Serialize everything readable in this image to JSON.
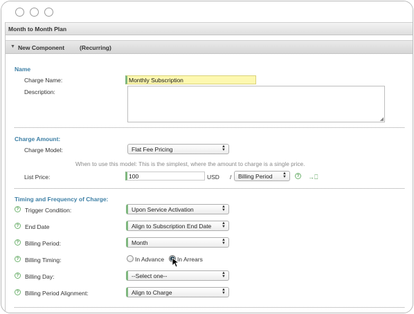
{
  "plan": {
    "title": "Month to Month Plan"
  },
  "component": {
    "label": "New Component",
    "type": "(Recurring)"
  },
  "sections": {
    "name": "Name",
    "charge_amount": "Charge Amount:",
    "timing": "Timing and Frequency of Charge:"
  },
  "fields": {
    "charge_name": {
      "label": "Charge Name:",
      "value": "Monthly Subscription"
    },
    "description": {
      "label": "Description:",
      "value": ""
    },
    "charge_model": {
      "label": "Charge Model:",
      "value": "Flat Fee Pricing",
      "hint": "When to use this model: This is the simplest, where the amount to charge is a single price."
    },
    "list_price": {
      "label": "List Price:",
      "value": "100",
      "currency": "USD",
      "separator": "/",
      "period": "Billing Period"
    },
    "trigger_condition": {
      "label": "Trigger Condition:",
      "value": "Upon Service Activation"
    },
    "end_date": {
      "label": "End Date",
      "value": "Align to Subscription End Date"
    },
    "billing_period": {
      "label": "Billing Period:",
      "value": "Month"
    },
    "billing_timing": {
      "label": "Billing Timing:",
      "option_advance": "In Advance",
      "option_arrears": "In Arrears",
      "selected": "In Arrears"
    },
    "billing_day": {
      "label": "Billing Day:",
      "value": "--Select one--"
    },
    "billing_period_alignment": {
      "label": "Billing Period Alignment:",
      "value": "Align to Charge"
    }
  },
  "icons": {
    "help": "help-circle-icon",
    "collapse": "caret-down-icon",
    "apply": "arrow-right-bracket-icon"
  },
  "colors": {
    "section_title": "#3d7fa5",
    "required_marker": "#7fb77f",
    "highlight": "#fdf8b0"
  }
}
